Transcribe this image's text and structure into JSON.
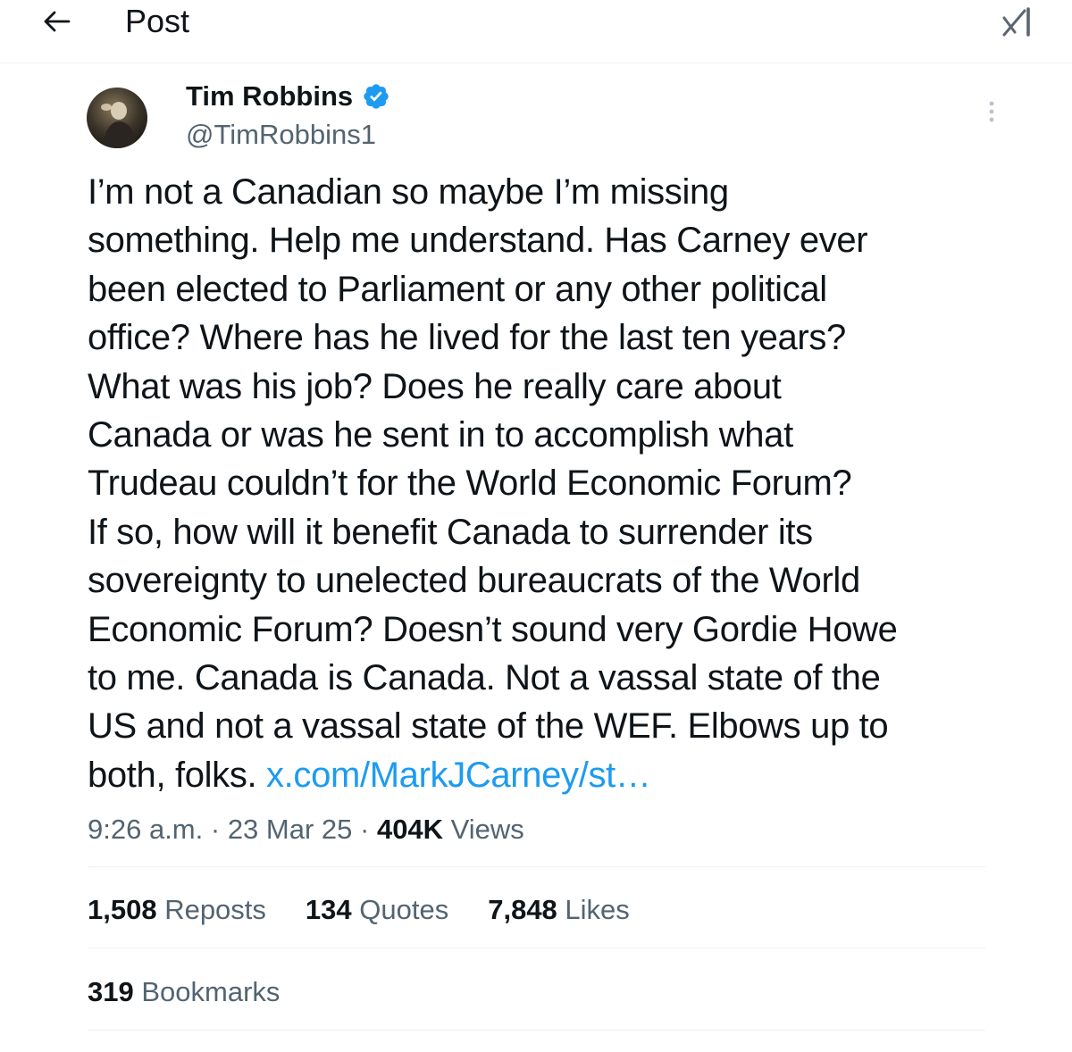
{
  "header": {
    "title": "Post",
    "back_icon": "arrow-left-icon",
    "grok_icon": "grok-icon"
  },
  "author": {
    "name": "Tim Robbins",
    "handle": "@TimRobbins1",
    "verified_color": "#1d9bf0"
  },
  "post": {
    "lines": [
      "I’m not a Canadian so maybe I’m missing",
      "something. Help me understand. Has Carney ever",
      "been elected to Parliament or any other political",
      "office? Where has he lived for the last ten years?",
      "What was his job? Does he really care about",
      "Canada or was he sent in to accomplish what",
      "Trudeau couldn’t for the World Economic Forum?",
      "If so, how will it benefit Canada to surrender its",
      "sovereignty to unelected bureaucrats of the World",
      "Economic Forum? Doesn’t sound very Gordie Howe",
      "to me. Canada is Canada. Not a vassal state of the",
      "US and not a vassal state of the WEF. Elbows up to"
    ],
    "last_line_text": "both, folks. ",
    "link_text": "x.com/MarkJCarney/st…",
    "link_color": "#1d9bf0"
  },
  "meta": {
    "time": "9:26 a.m.",
    "separator": " · ",
    "date": "23 Mar 25",
    "views_count": "404K",
    "views_label": " Views"
  },
  "stats": {
    "reposts_count": "1,508",
    "reposts_label": " Reposts",
    "quotes_count": "134",
    "quotes_label": " Quotes",
    "likes_count": "7,848",
    "likes_label": " Likes",
    "bookmarks_count": "319",
    "bookmarks_label": " Bookmarks"
  }
}
